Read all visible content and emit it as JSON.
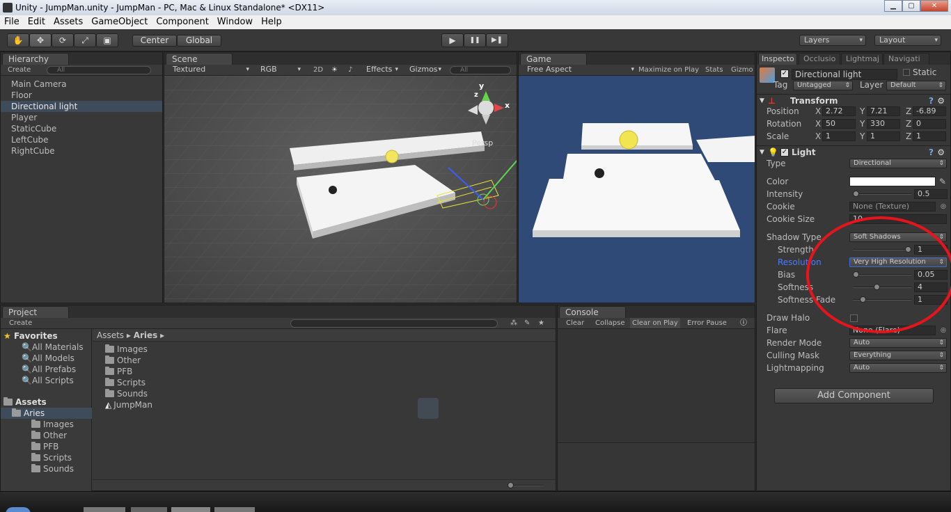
{
  "window": {
    "title": "Unity - JumpMan.unity - JumpMan - PC, Mac & Linux Standalone* <DX11>",
    "minimize": "▁",
    "maximize": "▢",
    "close": "✕"
  },
  "menu": [
    "File",
    "Edit",
    "Assets",
    "GameObject",
    "Component",
    "Window",
    "Help"
  ],
  "toolbar": {
    "hand": "✋",
    "move": "✥",
    "rotate": "⟳",
    "scale": "⤢",
    "rect": "▣",
    "pivot_center": "Center",
    "pivot_global": "Global",
    "play": "▶",
    "pause": "❚❚",
    "step": "▶❚",
    "layers": "Layers",
    "layout": "Layout"
  },
  "hierarchy": {
    "tab": "Hierarchy",
    "create": "Create",
    "search": "All",
    "items": [
      "Main Camera",
      "Floor",
      "Directional light",
      "Player",
      "StaticCube",
      "LeftCube",
      "RightCube"
    ],
    "selected_index": 2
  },
  "scene": {
    "tab": "Scene",
    "render_mode": "Textured",
    "color_mode": "RGB",
    "mode_2d": "2D",
    "effects": "Effects",
    "gizmos": "Gizmos",
    "search": "All",
    "persp_label": "Persp",
    "axis_x": "x",
    "axis_y": "y",
    "axis_z": "z"
  },
  "game": {
    "tab": "Game",
    "aspect": "Free Aspect",
    "maximize": "Maximize on Play",
    "stats": "Stats",
    "gizmos": "Gizmo"
  },
  "inspector": {
    "tabs": [
      "Inspecto",
      "Occlusio",
      "Lightmaj",
      "Navigati"
    ],
    "object_name": "Directional light",
    "static_label": "Static",
    "tag_label": "Tag",
    "tag_value": "Untagged",
    "layer_label": "Layer",
    "layer_value": "Default",
    "transform": {
      "title": "Transform",
      "position": {
        "label": "Position",
        "x": "2.72",
        "y": "7.21",
        "z": "-6.89"
      },
      "rotation": {
        "label": "Rotation",
        "x": "50",
        "y": "330",
        "z": "0"
      },
      "scale": {
        "label": "Scale",
        "x": "1",
        "y": "1",
        "z": "1"
      }
    },
    "light": {
      "title": "Light",
      "type_label": "Type",
      "type_value": "Directional",
      "color_label": "Color",
      "intensity_label": "Intensity",
      "intensity_value": "0.5",
      "cookie_label": "Cookie",
      "cookie_value": "None (Texture)",
      "cookie_size_label": "Cookie Size",
      "cookie_size_value": "10",
      "shadow_type_label": "Shadow Type",
      "shadow_type_value": "Soft Shadows",
      "strength_label": "Strength",
      "strength_value": "1",
      "resolution_label": "Resolution",
      "resolution_value": "Very High Resolution",
      "bias_label": "Bias",
      "bias_value": "0.05",
      "softness_label": "Softness",
      "softness_value": "4",
      "softness_fade_label": "Softness Fade",
      "softness_fade_value": "1",
      "draw_halo_label": "Draw Halo",
      "flare_label": "Flare",
      "flare_value": "None (Flare)",
      "render_mode_label": "Render Mode",
      "render_mode_value": "Auto",
      "culling_mask_label": "Culling Mask",
      "culling_mask_value": "Everything",
      "lightmapping_label": "Lightmapping",
      "lightmapping_value": "Auto"
    },
    "add_component": "Add Component"
  },
  "project": {
    "tab": "Project",
    "create": "Create",
    "favorites_label": "Favorites",
    "favorites": [
      "All Materials",
      "All Models",
      "All Prefabs",
      "All Scripts"
    ],
    "assets_label": "Assets",
    "aries_label": "Aries",
    "aries_children": [
      "Images",
      "Other",
      "PFB",
      "Scripts",
      "Sounds"
    ],
    "breadcrumb_root": "Assets",
    "breadcrumb_current": "Aries",
    "files": [
      "Images",
      "Other",
      "PFB",
      "Scripts",
      "Sounds",
      "JumpMan"
    ]
  },
  "console": {
    "tab": "Console",
    "buttons": [
      "Clear",
      "Collapse",
      "Clear on Play",
      "Error Pause"
    ]
  },
  "colors": {
    "selection": "#3e4b5a",
    "game_bg": "#304a78",
    "annotation": "#e8141c"
  }
}
